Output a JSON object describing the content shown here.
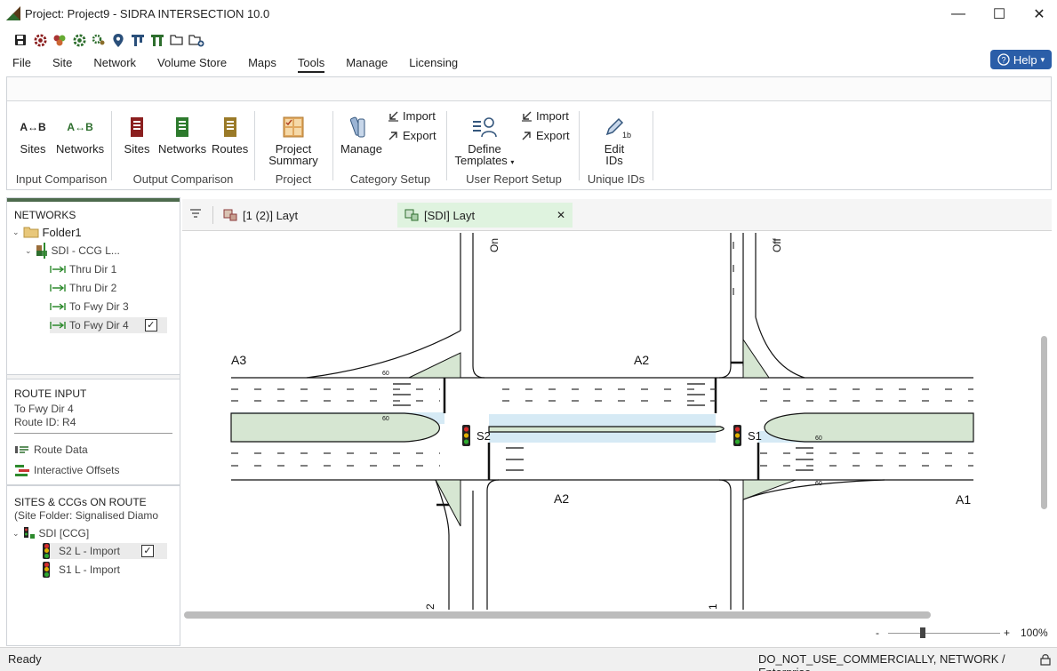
{
  "window": {
    "title": "Project: Project9  -  SIDRA INTERSECTION 10.0",
    "minimize": "—",
    "maximize": "☐",
    "close": "✕"
  },
  "quick_access": [
    "save-icon",
    "settings-red-icon",
    "settings-multi-icon",
    "settings-green-icon",
    "settings-gear-icon",
    "location-pin-icon",
    "route-icon",
    "network-icon",
    "open-folder-icon",
    "new-folder-icon"
  ],
  "menu": {
    "items": [
      "File",
      "Site",
      "Network",
      "Volume Store",
      "Maps",
      "Tools",
      "Manage",
      "Licensing"
    ],
    "active": "Tools"
  },
  "help_button": "Help",
  "ribbon": {
    "input_comparison": {
      "group_label": "Input Comparison",
      "sites": "Sites",
      "networks": "Networks",
      "icon_text": "A↔B"
    },
    "output_comparison": {
      "group_label": "Output Comparison",
      "sites": "Sites",
      "networks": "Networks",
      "routes": "Routes"
    },
    "project": {
      "group_label": "Project",
      "summary_line1": "Project",
      "summary_line2": "Summary"
    },
    "category_setup": {
      "group_label": "Category Setup",
      "manage": "Manage",
      "import": "Import",
      "export": "Export"
    },
    "user_report_setup": {
      "group_label": "User Report Setup",
      "define_line1": "Define",
      "define_line2": "Templates",
      "import": "Import",
      "export": "Export"
    },
    "unique_ids": {
      "group_label": "Unique IDs",
      "edit_line1": "Edit",
      "edit_line2": "IDs",
      "icon_badge": "1b"
    }
  },
  "left_panel": {
    "networks_heading": "NETWORKS",
    "folder": "Folder1",
    "network": "SDI - CCG L...",
    "routes": [
      "Thru Dir 1",
      "Thru Dir 2",
      "To Fwy Dir 3",
      "To Fwy Dir 4"
    ],
    "selected_route_check": "✓",
    "route_input_heading": "ROUTE INPUT",
    "route_name": "To Fwy Dir 4",
    "route_id": "Route ID:  R4",
    "route_data": "Route Data",
    "interactive_offsets": "Interactive Offsets",
    "sites_heading": "SITES & CCGs ON ROUTE",
    "site_folder": "(Site Folder: Signalised Diamo",
    "ccg": "SDI [CCG]",
    "sites": [
      "S2 L - Import",
      "S1 L - Import"
    ],
    "site_check": "✓"
  },
  "tabs": [
    {
      "label": "[1 (2)] Layt",
      "active": false
    },
    {
      "label": "[SDI] Layt",
      "active": true
    }
  ],
  "tab_close": "✕",
  "diagram": {
    "approach_labels": [
      "A3",
      "A2",
      "A2",
      "A1"
    ],
    "signal_labels": [
      "S2",
      "S1"
    ],
    "road_labels": [
      "On",
      "Off",
      "2",
      "1"
    ],
    "lane_speed": "60",
    "colors": {
      "median_green": "#d6e6d2",
      "highlight_blue": "#d6eaf5",
      "road_line": "#111111"
    }
  },
  "zoom": {
    "minus": "-",
    "plus": "+",
    "value": "100%",
    "level": 0.3
  },
  "status": {
    "left": "Ready",
    "right": "DO_NOT_USE_COMMERCIALLY, NETWORK / Enterprise"
  }
}
